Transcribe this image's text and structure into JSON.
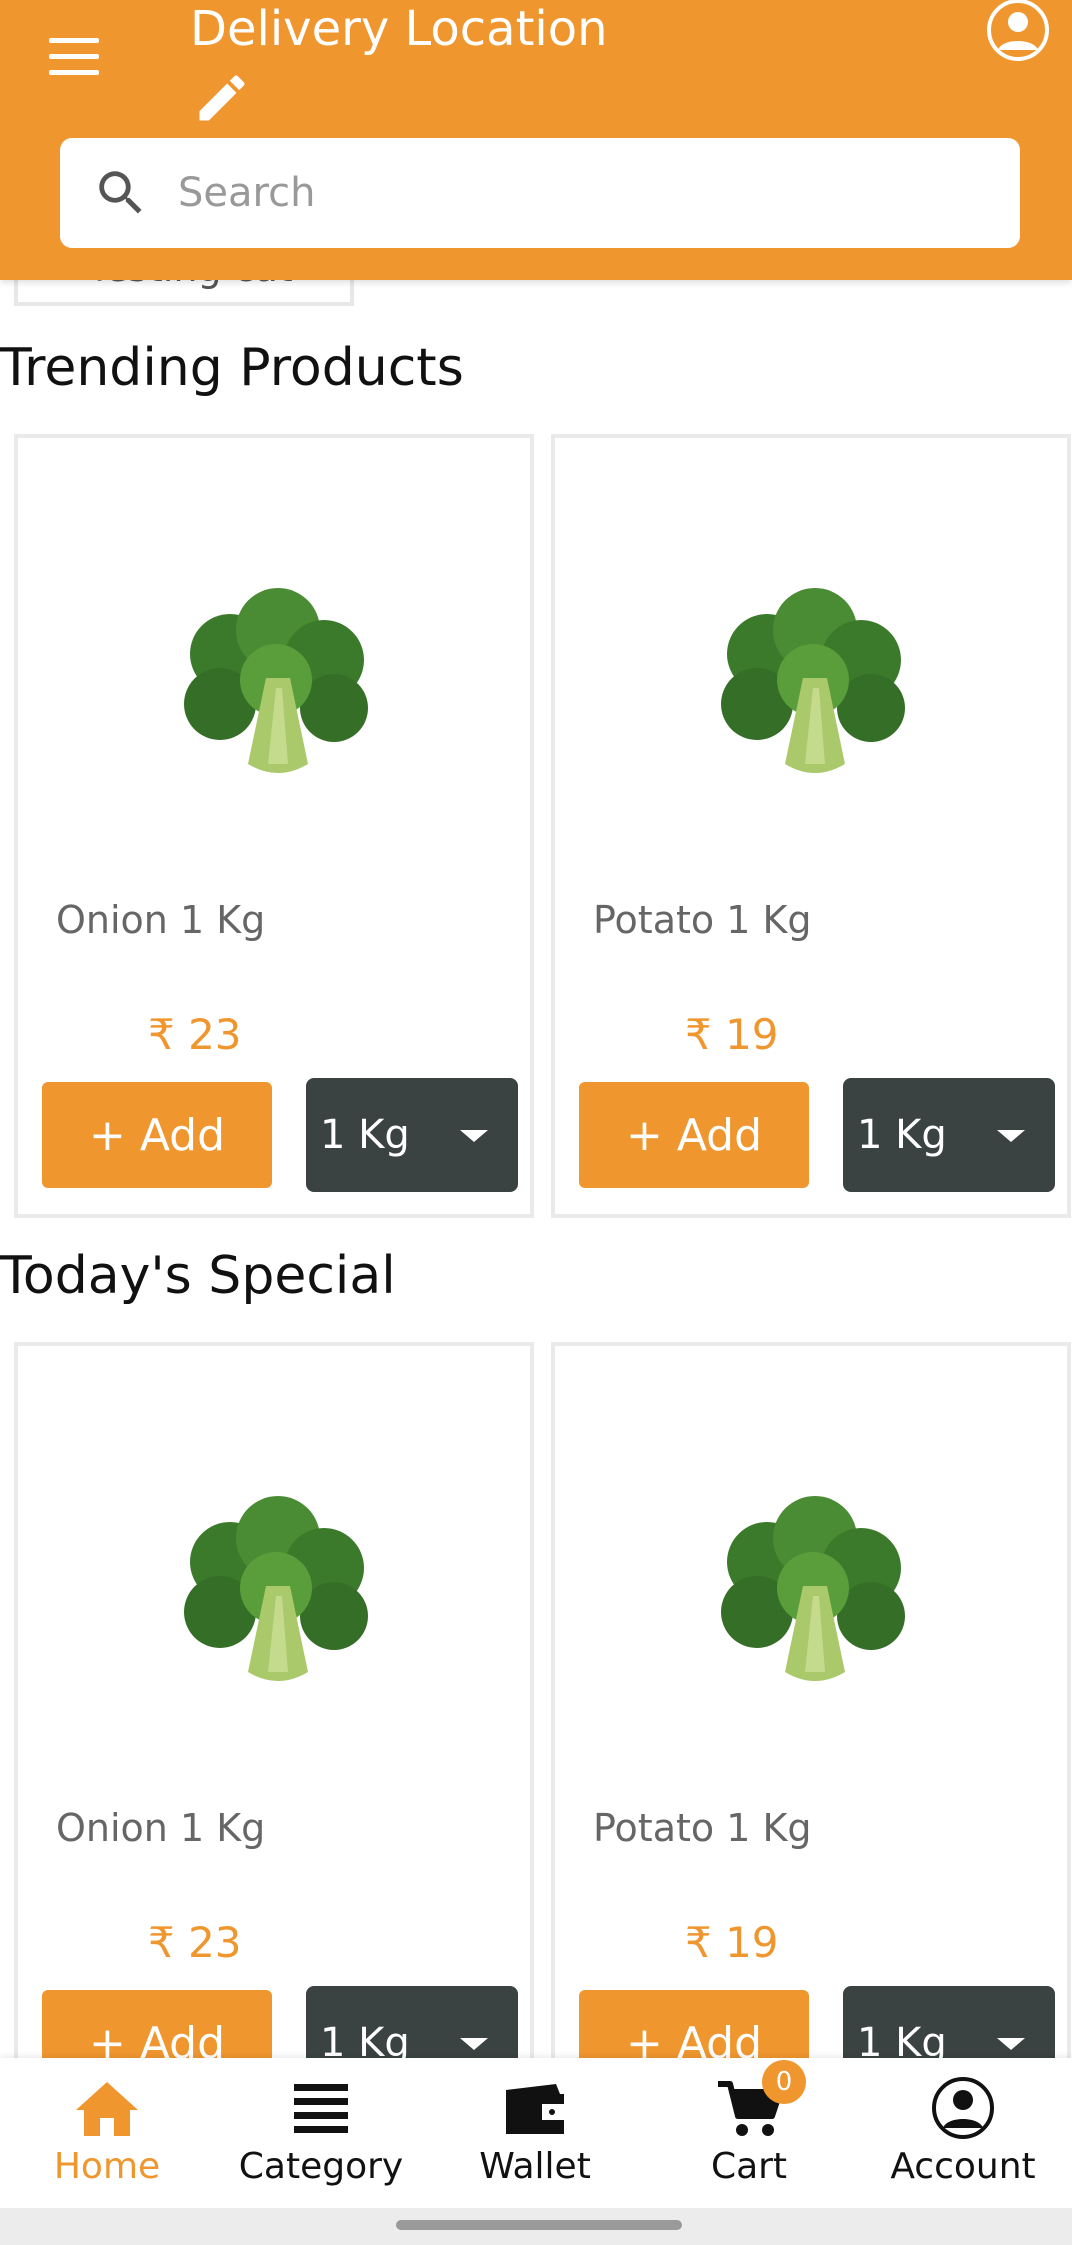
{
  "header": {
    "title": "Delivery Location",
    "search_placeholder": "Search",
    "background_color": "#F0962F",
    "icons": [
      "menu-icon",
      "edit-icon",
      "profile-icon",
      "search-icon"
    ]
  },
  "category_chip": {
    "label": "Testing cat"
  },
  "sections": [
    {
      "title": "Trending Products",
      "products": [
        {
          "name": "Onion 1 Kg",
          "price": "₹ 23",
          "add_label": "+ Add",
          "unit": "1 Kg"
        },
        {
          "name": "Potato 1 Kg",
          "price": "₹ 19",
          "add_label": "+ Add",
          "unit": "1 Kg"
        }
      ]
    },
    {
      "title": "Today's Special",
      "products": [
        {
          "name": "Onion 1 Kg",
          "price": "₹ 23",
          "add_label": "+ Add",
          "unit": "1 Kg"
        },
        {
          "name": "Potato 1 Kg",
          "price": "₹ 19",
          "add_label": "+ Add",
          "unit": "1 Kg"
        }
      ]
    }
  ],
  "bottom_nav": {
    "items": [
      {
        "label": "Home",
        "icon": "home-icon",
        "active": true
      },
      {
        "label": "Category",
        "icon": "category-icon",
        "active": false
      },
      {
        "label": "Wallet",
        "icon": "wallet-icon",
        "active": false
      },
      {
        "label": "Cart",
        "icon": "cart-icon",
        "active": false,
        "badge": "0"
      },
      {
        "label": "Account",
        "icon": "account-icon",
        "active": false
      }
    ]
  },
  "colors": {
    "accent": "#F0962F",
    "select_bg": "#3B4242",
    "text_muted": "#666666"
  }
}
